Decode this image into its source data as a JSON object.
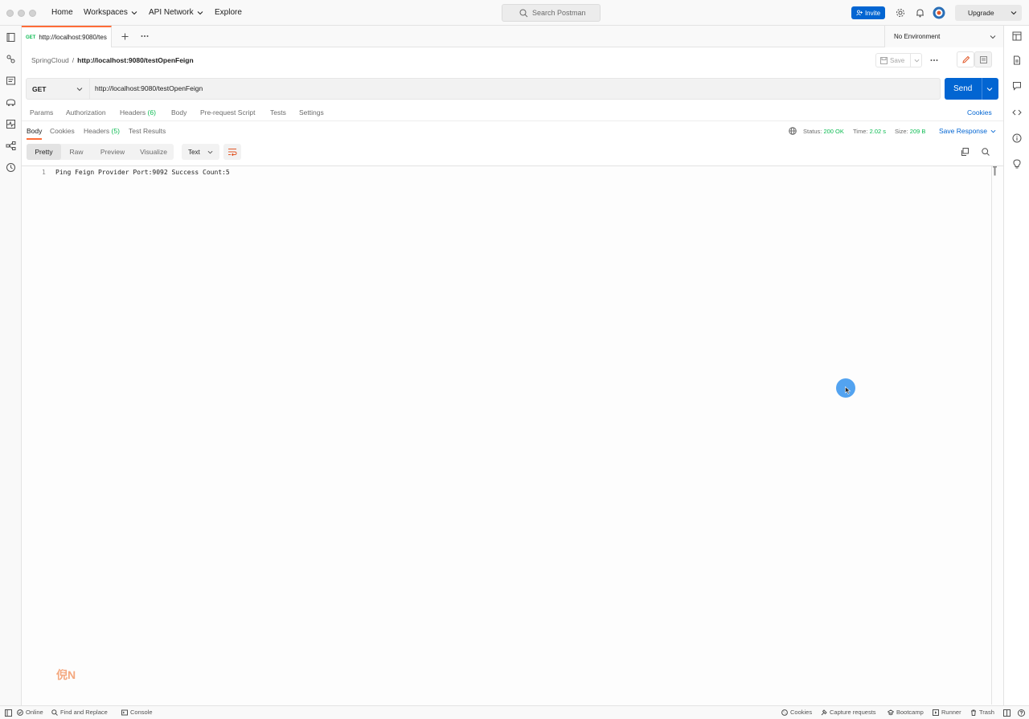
{
  "topbar": {
    "nav": [
      "Home",
      "Workspaces",
      "API Network",
      "Explore"
    ],
    "search_placeholder": "Search Postman",
    "invite_label": "Invite",
    "upgrade_label": "Upgrade"
  },
  "tab": {
    "method": "GET",
    "title": "http://localhost:9080/tes"
  },
  "environment": "No Environment",
  "breadcrumb": {
    "parent": "SpringCloud",
    "separator": "/",
    "current": "http://localhost:9080/testOpenFeign"
  },
  "save_label": "Save",
  "request": {
    "method": "GET",
    "url": "http://localhost:9080/testOpenFeign",
    "send_label": "Send"
  },
  "request_tabs": {
    "params": "Params",
    "authorization": "Authorization",
    "headers": "Headers",
    "headers_count": "(6)",
    "body": "Body",
    "prerequest": "Pre-request Script",
    "tests": "Tests",
    "settings": "Settings",
    "cookies": "Cookies"
  },
  "response_tabs": {
    "body": "Body",
    "cookies": "Cookies",
    "headers": "Headers",
    "headers_count": "(5)",
    "test_results": "Test Results"
  },
  "response_stats": {
    "status_label": "Status:",
    "status_value": "200 OK",
    "time_label": "Time:",
    "time_value": "2.02 s",
    "size_label": "Size:",
    "size_value": "209 B",
    "save_response": "Save Response"
  },
  "view_modes": [
    "Pretty",
    "Raw",
    "Preview",
    "Visualize"
  ],
  "view_active": "Pretty",
  "language": "Text",
  "editor": {
    "line_number": "1",
    "content": "Ping Feign Provider Port:9092 Success Count:5"
  },
  "watermark": "倪N",
  "statusbar": {
    "online": "Online",
    "find_replace": "Find and Replace",
    "console": "Console",
    "cookies": "Cookies",
    "capture": "Capture requests",
    "bootcamp": "Bootcamp",
    "runner": "Runner",
    "trash": "Trash"
  },
  "colors": {
    "accent_orange": "#ff6c37",
    "primary_blue": "#0265d2",
    "success_green": "#0cbb52"
  }
}
